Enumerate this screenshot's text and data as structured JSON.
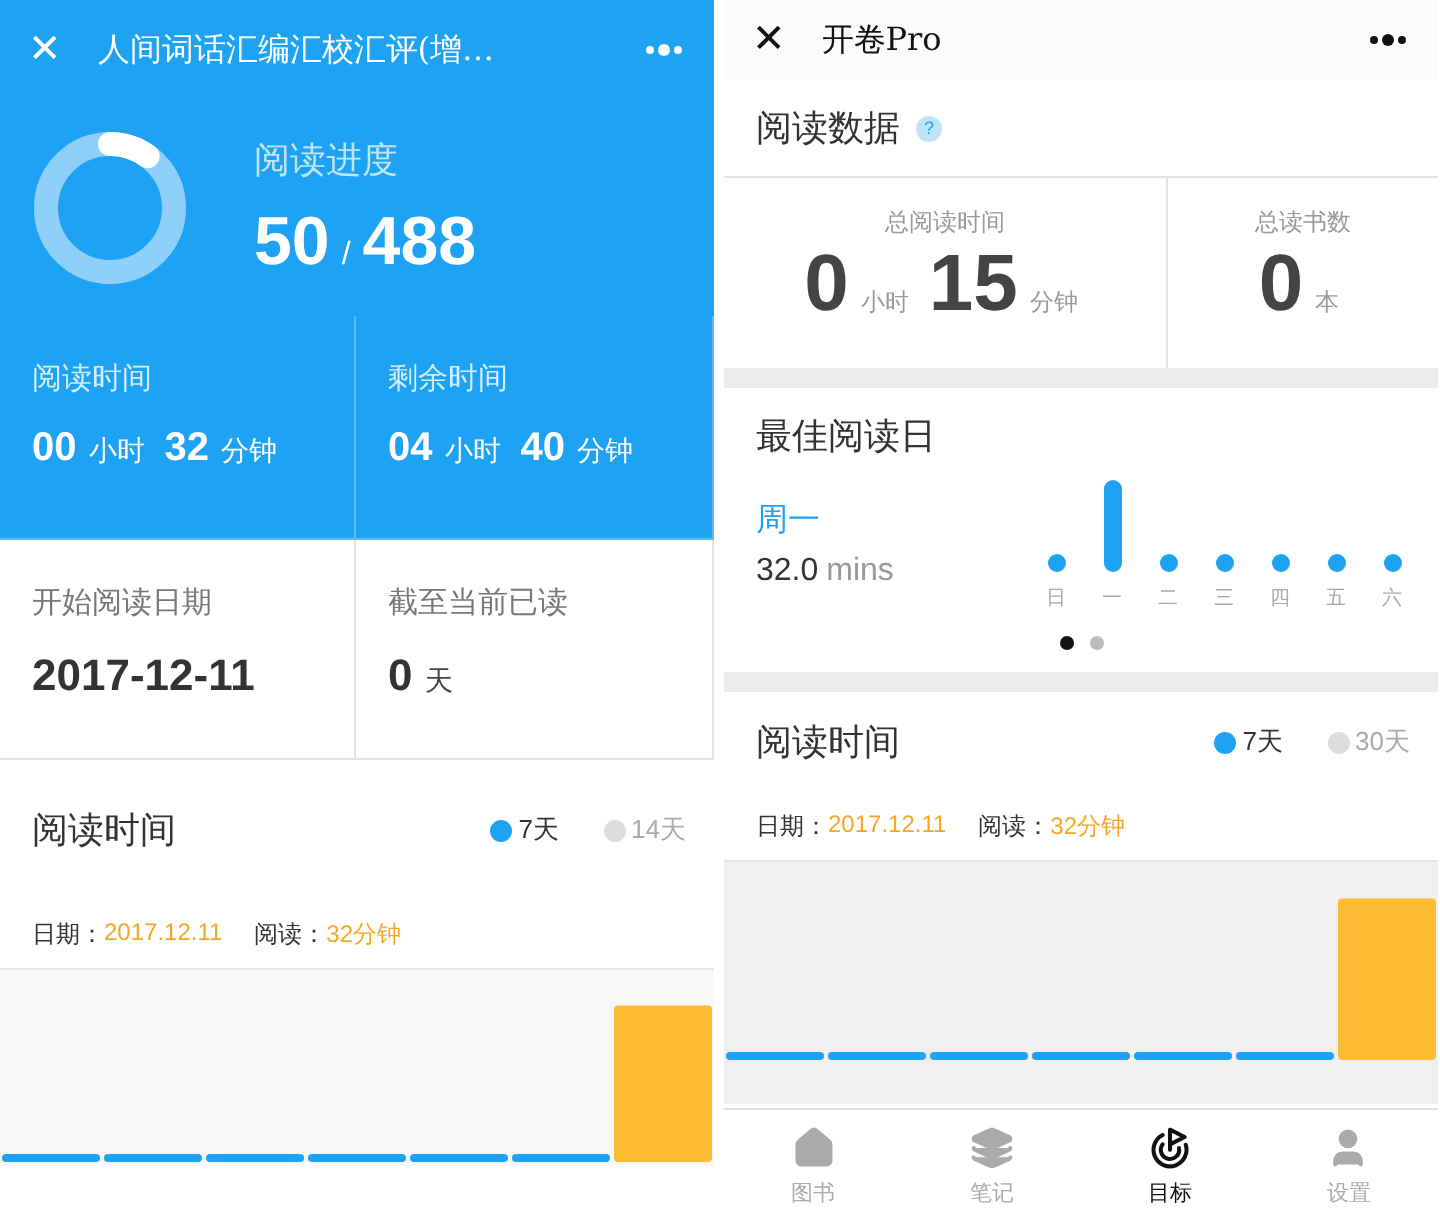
{
  "book_screen": {
    "title_bar": {
      "close": "✕",
      "title": "人间词话汇编汇校汇评(增…"
    },
    "progress": {
      "label": "阅读进度",
      "level": 0.1,
      "read": "50",
      "separator": "/",
      "total": "488"
    },
    "stats": [
      {
        "label": "阅读时间",
        "kind": "highlight",
        "parts": [
          {
            "text": "00",
            "kind": "number"
          },
          {
            "text": "小时",
            "kind": "unit"
          },
          {
            "text": "32",
            "kind": "number"
          },
          {
            "text": "分钟",
            "kind": "unit"
          }
        ]
      },
      {
        "label": "剩余时间",
        "kind": "highlight",
        "parts": [
          {
            "text": "04",
            "kind": "number"
          },
          {
            "text": "小时",
            "kind": "unit"
          },
          {
            "text": "40",
            "kind": "number"
          },
          {
            "text": "分钟",
            "kind": "unit"
          }
        ]
      },
      {
        "label": "开始阅读日期",
        "kind": "plain",
        "parts": [
          {
            "text": "2017-12-11",
            "kind": "number"
          }
        ]
      },
      {
        "label": "截至当前已读",
        "kind": "plain",
        "parts": [
          {
            "text": "0",
            "kind": "number"
          },
          {
            "text": "天",
            "kind": "unit"
          }
        ]
      }
    ],
    "reading_time": {
      "title": "阅读时间",
      "ranges": [
        {
          "label": "7天",
          "selected": true
        },
        {
          "label": "14天",
          "selected": false
        }
      ],
      "date_label": "日期：",
      "date": "2017.12.11",
      "read_label": "阅读：",
      "read": "32分钟",
      "bars": [
        {
          "selected": false
        },
        {
          "selected": false
        },
        {
          "selected": false
        },
        {
          "selected": false
        },
        {
          "selected": false
        },
        {
          "selected": false
        },
        {
          "selected": true
        }
      ]
    }
  },
  "stats_screen": {
    "title_bar": {
      "close": "✕",
      "title": "开卷Pro"
    },
    "reading_data": {
      "title": "阅读数据",
      "help": "?",
      "cells": [
        {
          "label": "总阅读时间",
          "parts": [
            {
              "text": "0",
              "kind": "number"
            },
            {
              "text": "小时",
              "kind": "unit"
            },
            {
              "text": "15",
              "kind": "number"
            },
            {
              "text": "分钟",
              "kind": "unit"
            }
          ]
        },
        {
          "label": "总读书数",
          "parts": [
            {
              "text": "0",
              "kind": "number"
            },
            {
              "text": "本",
              "kind": "unit"
            }
          ]
        }
      ]
    },
    "best_day": {
      "title": "最佳阅读日",
      "day": "周一",
      "minutes": "32.0",
      "unit": "mins",
      "days": [
        {
          "label": "日",
          "selected": false
        },
        {
          "label": "一",
          "selected": true
        },
        {
          "label": "二",
          "selected": false
        },
        {
          "label": "三",
          "selected": false
        },
        {
          "label": "四",
          "selected": false
        },
        {
          "label": "五",
          "selected": false
        },
        {
          "label": "六",
          "selected": false
        }
      ],
      "pages": [
        {
          "selected": true
        },
        {
          "selected": false
        }
      ]
    },
    "reading_time": {
      "title": "阅读时间",
      "ranges": [
        {
          "label": "7天",
          "selected": true
        },
        {
          "label": "30天",
          "selected": false
        }
      ],
      "date_label": "日期：",
      "date": "2017.12.11",
      "read_label": "阅读：",
      "read": "32分钟",
      "bars": [
        {
          "selected": false
        },
        {
          "selected": false
        },
        {
          "selected": false
        },
        {
          "selected": false
        },
        {
          "selected": false
        },
        {
          "selected": false
        },
        {
          "selected": true
        }
      ]
    },
    "tab_bar": [
      {
        "label": "图书",
        "selected": false
      },
      {
        "label": "笔记",
        "selected": false
      },
      {
        "label": "目标",
        "selected": true
      },
      {
        "label": "设置",
        "selected": false
      }
    ]
  }
}
